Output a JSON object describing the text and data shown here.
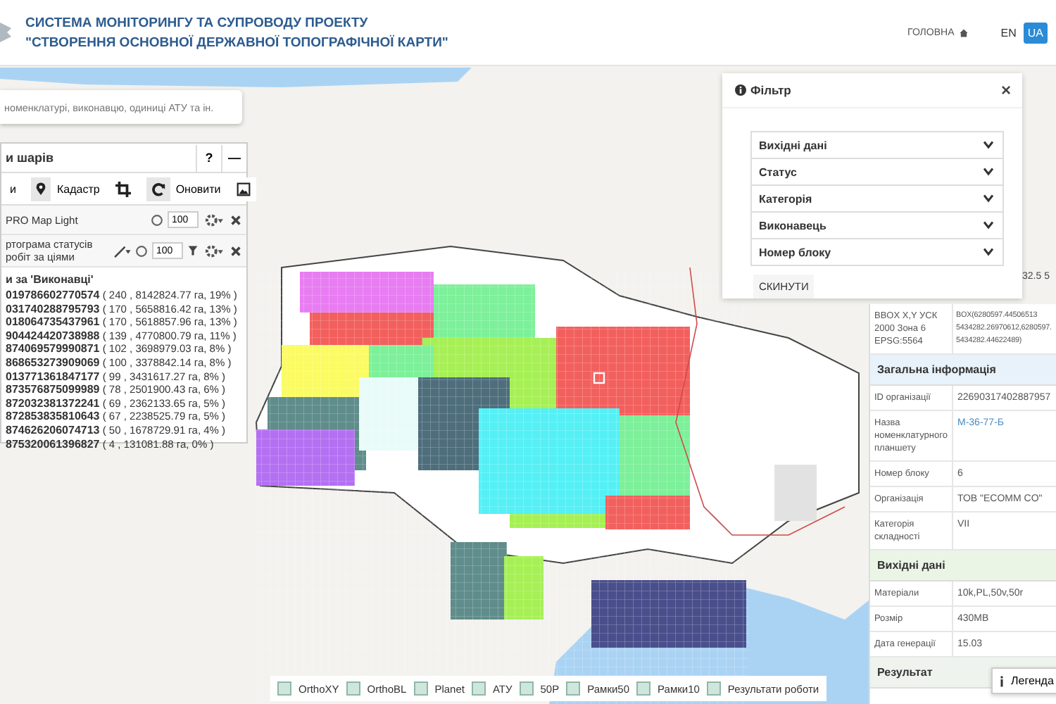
{
  "header": {
    "title_lines": [
      "СИСТЕМА МОНІТОРИНГУ ТА СУПРОВОДУ ПРОЕКТУ",
      "\"СТВОРЕННЯ ОСНОВНОЇ ДЕРЖАВНОЇ ТОПОГРАФІЧНОЇ КАРТИ\""
    ],
    "nav_link": "ГОЛОВНА",
    "languages": [
      {
        "label": "EN",
        "selected": false
      },
      {
        "label": "UA",
        "selected": true
      }
    ]
  },
  "search": {
    "placeholder": "номенклатурі, виконавцю, одиниці АТУ та ін."
  },
  "layers_panel": {
    "title": "и шарів",
    "help": "?",
    "minimize": "—",
    "toolbar": [
      {
        "kind": "text",
        "label": "и"
      },
      {
        "kind": "pin",
        "label": "Кадастр"
      },
      {
        "kind": "crop"
      },
      {
        "kind": "refresh",
        "label": "Оновити"
      },
      {
        "kind": "image"
      }
    ],
    "layers": [
      {
        "kind": "base",
        "name": "PRO Map Light",
        "opacity": "100"
      },
      {
        "kind": "thematic",
        "name": "ртограма статусів робіт за ціями",
        "opacity": "100"
      }
    ],
    "legend_title": "и за 'Виконавці'",
    "legend_rows": [
      {
        "id": "019786602770574",
        "stats": "( 240 , 8142824.77 га, 19% )"
      },
      {
        "id": "031740288795793",
        "stats": "( 170 , 5658816.42 га, 13% )"
      },
      {
        "id": "018064735437961",
        "stats": "( 170 , 5618857.96 га, 13% )"
      },
      {
        "id": "904424420738988",
        "stats": "( 139 , 4770800.79 га, 11% )"
      },
      {
        "id": "874069579990871",
        "stats": "( 102 , 3698979.03 га, 8% )"
      },
      {
        "id": "868653273909069",
        "stats": "( 100 , 3378842.14 га, 8% )"
      },
      {
        "id": "013771361847177",
        "stats": "( 99 , 3431617.27 га, 8% )"
      },
      {
        "id": "873576875099989",
        "stats": "( 78 , 2501900.43 га, 6% )"
      },
      {
        "id": "872032381372241",
        "stats": "( 69 , 2362133.65 га, 5% )"
      },
      {
        "id": "872853835810643",
        "stats": "( 67 , 2238525.79 га, 5% )"
      },
      {
        "id": "874626206074713",
        "stats": "( 50 , 1678729.91 га, 4% )"
      },
      {
        "id": "875320061396827",
        "stats": "( 4 , 131081.88 га, 0% )"
      }
    ]
  },
  "filter": {
    "title": "Фільтр",
    "close": "×",
    "sections": [
      {
        "label": "Вихідні дані",
        "expanded": false
      },
      {
        "label": "Статус",
        "expanded": false
      },
      {
        "label": "Категорія",
        "expanded": false
      },
      {
        "label": "Виконавець",
        "expanded": false
      },
      {
        "label": "Номер блоку",
        "expanded": false
      }
    ],
    "reset_button": "СКИНУТИ"
  },
  "coordinates": "32.5 5",
  "info_panel": {
    "rows": [
      {
        "kind": "bbox",
        "label": "BBOX X,Y УСК 2000 Зона 6 EPSG:5564",
        "value_lines": [
          "BOX(6280597.44506513",
          "5434282.26970612,6280597.",
          "5434282.44622489)"
        ]
      },
      {
        "kind": "header",
        "label": "Загальна інформація",
        "color": "#e8f2fb"
      },
      {
        "kind": "row",
        "label": "ID організації",
        "value": "22690317402887957"
      },
      {
        "kind": "link",
        "label": "Назва номенклатурного планшету",
        "value": "М-36-77-Б"
      },
      {
        "kind": "row",
        "label": "Номер блоку",
        "value": "6"
      },
      {
        "kind": "row",
        "label": "Організація",
        "value": "ТОВ \"ECOMM CO\""
      },
      {
        "kind": "row",
        "label": "Категорія складності",
        "value": "VII"
      },
      {
        "kind": "header",
        "label": "Вихідні дані",
        "color": "#eaf5e6"
      },
      {
        "kind": "row",
        "label": "Матеріали",
        "value": "10k,PL,50v,50r"
      },
      {
        "kind": "row",
        "label": "Розмір",
        "value": "430MB"
      },
      {
        "kind": "row",
        "label": "Дата генерації",
        "value": "15.03"
      },
      {
        "kind": "header",
        "label": "Результат",
        "color": "#eef3ee"
      }
    ]
  },
  "legend_layers": [
    {
      "label": "OrthoXY",
      "checked": false
    },
    {
      "label": "OrthoBL",
      "checked": false
    },
    {
      "label": "Planet",
      "checked": false
    },
    {
      "label": "АТУ",
      "checked": false
    },
    {
      "label": "50P",
      "checked": false
    },
    {
      "label": "Рамки50",
      "checked": false
    },
    {
      "label": "Рамки10",
      "checked": false
    },
    {
      "label": "Результати роботи",
      "checked": false
    }
  ],
  "legend_button": "Легенда"
}
